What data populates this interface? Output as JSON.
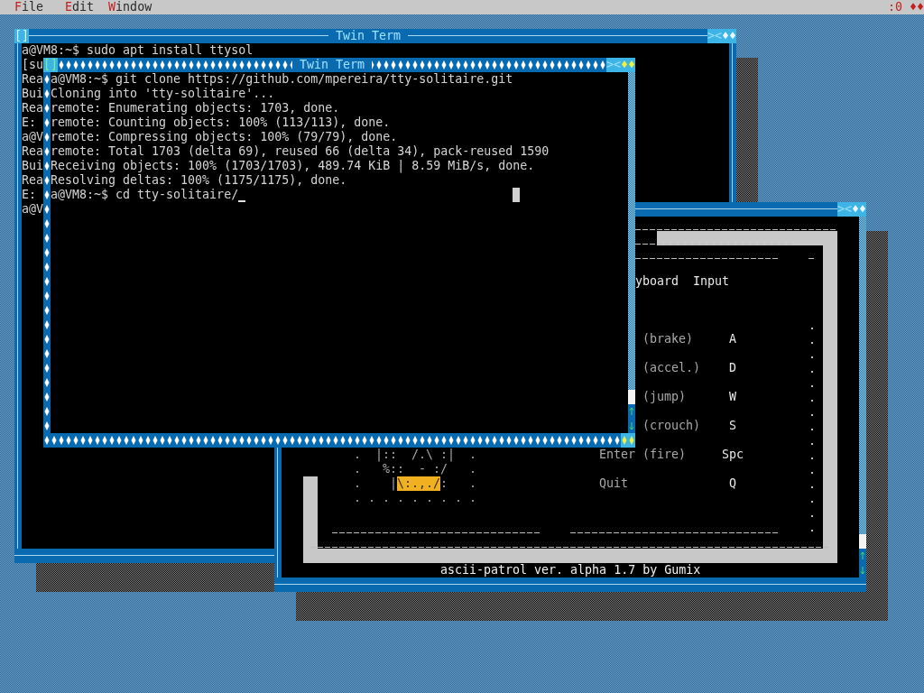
{
  "menu_bar": {
    "items": [
      {
        "hotkey": "F",
        "rest": "ile"
      },
      {
        "hotkey": "E",
        "rest": "dit"
      },
      {
        "hotkey": "W",
        "rest": "indow"
      }
    ],
    "display": ":0",
    "corner_button": "♦♦"
  },
  "windows": [
    {
      "kind": "terminal",
      "title": "Twin Term",
      "focused": false,
      "close_button": "[]",
      "buttons": [
        "><",
        "♦♦"
      ],
      "lines": [
        "a@VM8:~$ sudo apt install ttysol",
        "[su",
        "Rea",
        "Bui",
        "Rea",
        "E:",
        "a@V",
        "Rea",
        "Bui",
        "Rea",
        "E:",
        "a@V"
      ]
    },
    {
      "kind": "game",
      "focused": false,
      "buttons": [
        "><",
        "♦♦"
      ],
      "header": [
        "yboard",
        "Input"
      ],
      "controls": [
        {
          "action": "(brake)",
          "key": "A"
        },
        {
          "action": "(accel.)",
          "key": "D"
        },
        {
          "action": "(jump)",
          "key": "W"
        },
        {
          "action": "(crouch)",
          "key": "S"
        },
        {
          "label": "Enter",
          "action": "(fire)",
          "key": "Spc"
        },
        {
          "label": "Quit",
          "key": "Q"
        }
      ],
      "art": [
        [
          {
            "text": ".  |::  /.\\ :|  .",
            "highlight": false
          }
        ],
        [
          {
            "text": ".   %::  - :/   .",
            "highlight": false
          }
        ],
        [
          {
            "text": ".    |",
            "highlight": false
          },
          {
            "text": "\\:.,./",
            "highlight": true
          },
          {
            "text": ":   .",
            "highlight": false
          }
        ],
        [
          {
            "text": ". . . . . . . . .",
            "highlight": false
          }
        ]
      ],
      "footer": "ascii-patrol ver. alpha 1.7 by Gumix"
    },
    {
      "kind": "terminal",
      "title": "Twin Term",
      "focused": true,
      "close_button": "[]",
      "buttons": [
        "><",
        "♦♦"
      ],
      "cursor": true,
      "lines": [
        "a@VM8:~$ git clone https://github.com/mpereira/tty-solitaire.git",
        "Cloning into 'tty-solitaire'...",
        "remote: Enumerating objects: 1703, done.",
        "remote: Counting objects: 100% (113/113), done.",
        "remote: Compressing objects: 100% (79/79), done.",
        "remote: Total 1703 (delta 69), reused 66 (delta 34), pack-reused 1590",
        "Receiving objects: 100% (1703/1703), 489.74 KiB | 8.59 MiB/s, done.",
        "Resolving deltas: 100% (1175/1175), done.",
        "a@VM8:~$ cd tty-solitaire/"
      ]
    }
  ]
}
